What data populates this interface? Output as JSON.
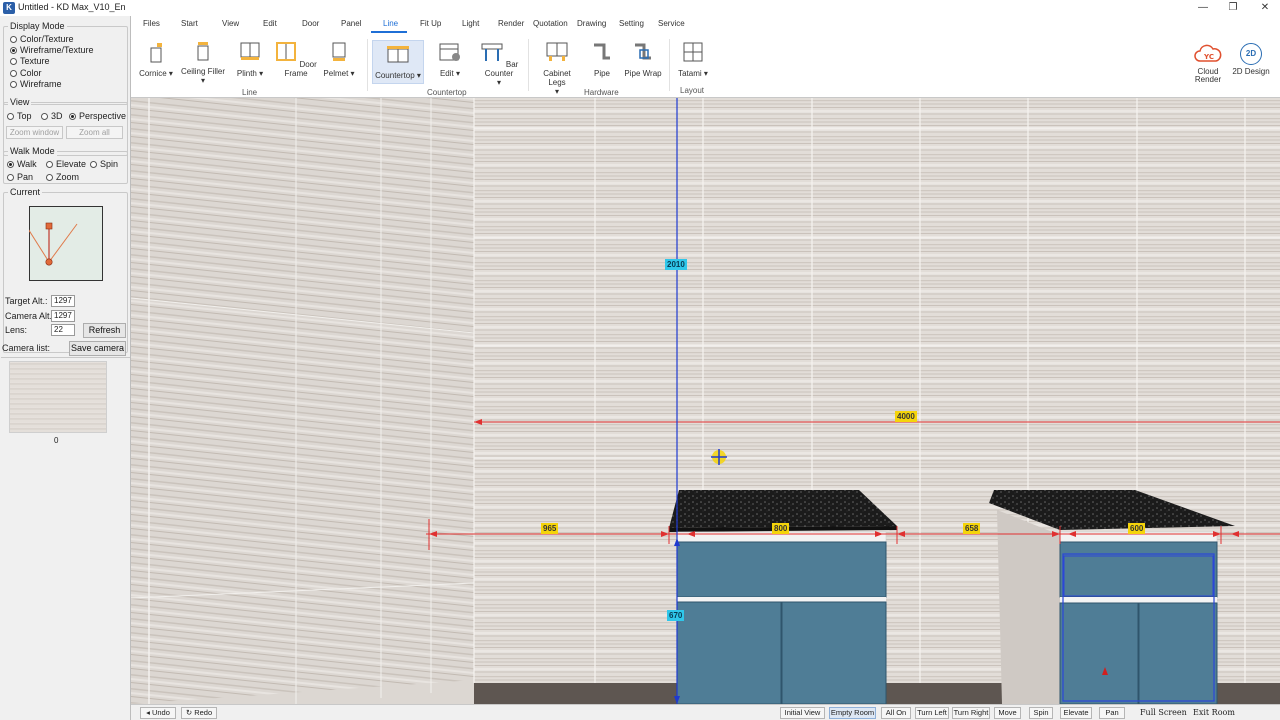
{
  "window": {
    "title": "Untitled - KD Max_V10_En",
    "app_icon": "K"
  },
  "left_panel": {
    "display_mode": {
      "title": "Display Mode",
      "options": [
        "Color/Texture",
        "Wireframe/Texture",
        "Texture",
        "Color",
        "Wireframe"
      ],
      "selected": "Wireframe/Texture"
    },
    "view": {
      "title": "View",
      "options": [
        "Top",
        "3D",
        "Perspective"
      ],
      "selected": "Perspective",
      "zoom_window": "Zoom window",
      "zoom_all": "Zoom all"
    },
    "walk_mode": {
      "title": "Walk Mode",
      "options": [
        "Walk",
        "Elevate",
        "Spin",
        "Pan",
        "Zoom"
      ],
      "selected": "Walk"
    },
    "current": {
      "title": "Current",
      "target_alt_label": "Target Alt.:",
      "target_alt": "1297",
      "camera_alt_label": "Camera Alt.:",
      "camera_alt": "1297",
      "lens_label": "Lens:",
      "lens": "22",
      "refresh": "Refresh"
    },
    "camera_list": {
      "label": "Camera list:",
      "save_camera": "Save camera",
      "thumb_index": "0"
    }
  },
  "menu_tabs": [
    "Files",
    "Start",
    "View",
    "Edit",
    "Door",
    "Panel",
    "Line",
    "Fit Up",
    "Light",
    "Render",
    "Quotation",
    "Drawing",
    "Setting",
    "Service"
  ],
  "active_tab": "Line",
  "ribbon": {
    "tools": [
      {
        "label": "Cornice",
        "icon": "cornice-icon",
        "dropdown": true
      },
      {
        "label": "Ceiling Filler",
        "icon": "ceiling-filler-icon",
        "dropdown": true
      },
      {
        "label": "Plinth",
        "icon": "plinth-icon",
        "dropdown": true
      },
      {
        "label": "Door Frame",
        "icon": "door-frame-icon",
        "dropdown": false
      },
      {
        "label": "Pelmet",
        "icon": "pelmet-icon",
        "dropdown": true
      },
      {
        "label": "Countertop",
        "icon": "countertop-icon",
        "dropdown": true
      },
      {
        "label": "Edit",
        "icon": "edit-icon",
        "dropdown": true
      },
      {
        "label": "Bar Counter",
        "icon": "bar-counter-icon",
        "dropdown": true
      },
      {
        "label": "Cabinet Legs",
        "icon": "cabinet-legs-icon",
        "dropdown": true
      },
      {
        "label": "Pipe",
        "icon": "pipe-icon",
        "dropdown": false
      },
      {
        "label": "Pipe Wrap",
        "icon": "pipe-wrap-icon",
        "dropdown": false
      },
      {
        "label": "Tatami",
        "icon": "tatami-icon",
        "dropdown": true
      }
    ],
    "groups": [
      "Line",
      "Countertop",
      "Hardware",
      "Layout"
    ],
    "right_tools": [
      {
        "label_line1": "Cloud",
        "label_line2": "Render",
        "icon": "cloud-render-icon"
      },
      {
        "label_line1": "2D Design",
        "label_line2": "",
        "icon": "2d-design-icon",
        "badge": "2D"
      }
    ]
  },
  "viewport": {
    "dimensions": [
      {
        "name": "height-2010",
        "value": "2010",
        "color": "cyan"
      },
      {
        "name": "width-4000",
        "value": "4000",
        "color": "yellow"
      },
      {
        "name": "left-gap-965",
        "value": "965",
        "color": "yellow"
      },
      {
        "name": "cabinet1-width-800",
        "value": "800",
        "color": "yellow"
      },
      {
        "name": "gap-658",
        "value": "658",
        "color": "yellow"
      },
      {
        "name": "cabinet2-width-600",
        "value": "600",
        "color": "yellow"
      },
      {
        "name": "cabinet-height-670",
        "value": "670",
        "color": "cyan"
      }
    ],
    "colors": {
      "cabinet": "#4f7d96",
      "countertop": "#1c1c1c",
      "dim_line": "#e03030",
      "axis_line": "#1f3ad0",
      "tile": "#dad5d0"
    }
  },
  "status_bar": {
    "left": [
      "Undo",
      "Redo"
    ],
    "buttons": [
      "Initial View",
      "Empty Room",
      "All On",
      "Turn Left",
      "Turn Right",
      "Move",
      "Spin",
      "Elevate",
      "Pan"
    ],
    "active": "Empty Room",
    "text_buttons": [
      "Full Screen",
      "Exit Room"
    ]
  }
}
